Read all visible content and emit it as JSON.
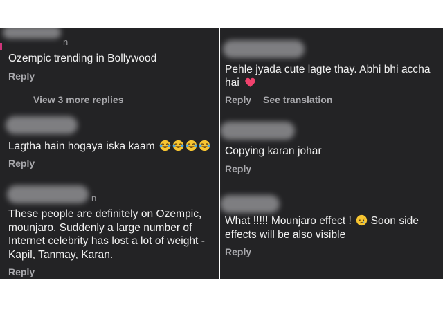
{
  "left_column": {
    "comments": [
      {
        "name_tail": "n",
        "text": "Ozempic trending in Bollywood",
        "reply_label": "Reply",
        "view_more_label": "View 3 more replies"
      },
      {
        "name_tail": "",
        "text": "Lagtha hain hogaya iska kaam",
        "emoji": [
          "laughing-tears-emoji",
          "laughing-tears-emoji",
          "laughing-tears-emoji",
          "laughing-tears-emoji"
        ],
        "reply_label": "Reply"
      },
      {
        "name_tail": "n",
        "text_lines": [
          "These people are definitely on Ozempic,",
          "mounjaro. Suddenly a large number of",
          "Internet celebrity has lost a lot of weight -",
          "Kapil, Tanmay, Karan."
        ],
        "reply_label": "Reply"
      }
    ]
  },
  "right_column": {
    "comments": [
      {
        "text_lines": [
          "Pehle jyada cute lagte thay. Abhi bhi accha",
          "hai"
        ],
        "emoji": [
          "heart-emoji"
        ],
        "reply_label": "Reply",
        "translation_label": "See translation"
      },
      {
        "text": "Copying karan johar",
        "reply_label": "Reply"
      },
      {
        "text_lines": [
          "What !!!!! Mounjaro effect !",
          "Soon side",
          "effects will be also visible"
        ],
        "emoji": [
          "crying-face-emoji"
        ],
        "reply_label": "Reply"
      }
    ]
  },
  "colors": {
    "panel_background": "#232325",
    "text": "#f1f1f1",
    "secondary_text": "#a9a9ad",
    "heart": "#f0426d",
    "emoji_yellow": "#f7c531"
  }
}
